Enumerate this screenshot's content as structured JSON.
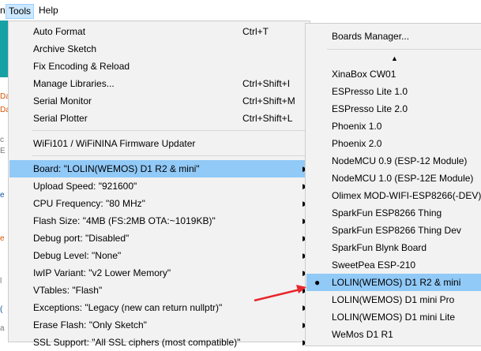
{
  "menubar": {
    "fragment": "n",
    "tools": "Tools",
    "help": "Help"
  },
  "editor_fragments": [
    "Da",
    "Da",
    "c",
    "E",
    "e",
    "e",
    "l",
    "(",
    "a"
  ],
  "tools_menu": {
    "items": [
      {
        "label": "Auto Format",
        "shortcut": "Ctrl+T"
      },
      {
        "label": "Archive Sketch",
        "shortcut": ""
      },
      {
        "label": "Fix Encoding & Reload",
        "shortcut": ""
      },
      {
        "label": "Manage Libraries...",
        "shortcut": "Ctrl+Shift+I"
      },
      {
        "label": "Serial Monitor",
        "shortcut": "Ctrl+Shift+M"
      },
      {
        "label": "Serial Plotter",
        "shortcut": "Ctrl+Shift+L"
      },
      {
        "label": "WiFi101 / WiFiNINA Firmware Updater",
        "shortcut": ""
      },
      {
        "label": "Board: \"LOLIN(WEMOS) D1 R2 & mini\"",
        "shortcut": ""
      },
      {
        "label": "Upload Speed: \"921600\"",
        "shortcut": ""
      },
      {
        "label": "CPU Frequency: \"80 MHz\"",
        "shortcut": ""
      },
      {
        "label": "Flash Size: \"4MB (FS:2MB OTA:~1019KB)\"",
        "shortcut": ""
      },
      {
        "label": "Debug port: \"Disabled\"",
        "shortcut": ""
      },
      {
        "label": "Debug Level: \"None\"",
        "shortcut": ""
      },
      {
        "label": "IwIP Variant: \"v2 Lower Memory\"",
        "shortcut": ""
      },
      {
        "label": "VTables: \"Flash\"",
        "shortcut": ""
      },
      {
        "label": "Exceptions: \"Legacy (new can return nullptr)\"",
        "shortcut": ""
      },
      {
        "label": "Erase Flash: \"Only Sketch\"",
        "shortcut": ""
      },
      {
        "label": "SSL Support: \"All SSL ciphers (most compatible)\"",
        "shortcut": ""
      }
    ],
    "submenu_arrow": "▶"
  },
  "board_submenu": {
    "boards_manager": "Boards Manager...",
    "scroll_up": "▲",
    "items": [
      "XinaBox CW01",
      "ESPresso Lite 1.0",
      "ESPresso Lite 2.0",
      "Phoenix 1.0",
      "Phoenix 2.0",
      "NodeMCU 0.9 (ESP-12 Module)",
      "NodeMCU 1.0 (ESP-12E Module)",
      "Olimex MOD-WIFI-ESP8266(-DEV)",
      "SparkFun ESP8266 Thing",
      "SparkFun ESP8266 Thing Dev",
      "SparkFun Blynk Board",
      "SweetPea ESP-210",
      "LOLIN(WEMOS) D1 R2 & mini",
      "LOLIN(WEMOS) D1 mini Pro",
      "LOLIN(WEMOS) D1 mini Lite",
      "WeMos D1 R1"
    ],
    "selected_bullet": "●"
  },
  "colors": {
    "highlight": "#91c9f7",
    "menu_bg": "#f2f2f2",
    "arrow_red": "#e8262c",
    "editor_teal": "#17a1a5"
  }
}
